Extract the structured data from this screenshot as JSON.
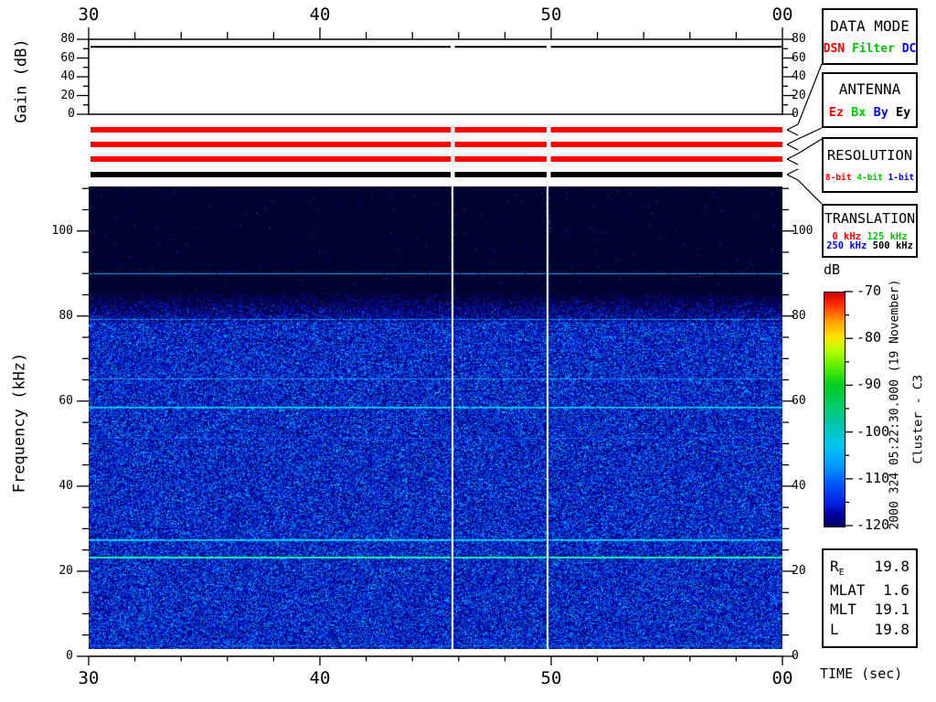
{
  "titles": {
    "gain_ylabel": "Gain (dB)",
    "freq_ylabel": "Frequency (kHz)",
    "time_label": "TIME (sec)",
    "db_label": "dB",
    "timestamp_vertical": "2000 324 05:22:30.000 (19 November)",
    "spacecraft_vertical": "Cluster - C3"
  },
  "axes": {
    "time_ticks": [
      "30",
      "40",
      "50",
      "00"
    ],
    "gain_ticks": [
      "0",
      "20",
      "40",
      "60",
      "80"
    ],
    "freq_ticks": [
      "0",
      "20",
      "40",
      "60",
      "80",
      "100"
    ],
    "colorbar_ticks": [
      "-70",
      "-80",
      "-90",
      "-100",
      "-110",
      "-120"
    ]
  },
  "legend": {
    "data_mode": {
      "title": "DATA MODE",
      "values": [
        {
          "text": "DSN",
          "color": "#ff0000"
        },
        {
          "text": "Filter",
          "color": "#00cc00"
        },
        {
          "text": "DC",
          "color": "#0000ff"
        }
      ]
    },
    "antenna": {
      "title": "ANTENNA",
      "values": [
        {
          "text": "Ez",
          "color": "#ff0000"
        },
        {
          "text": "Bx",
          "color": "#00cc00"
        },
        {
          "text": "By",
          "color": "#0000ff"
        },
        {
          "text": "Ey",
          "color": "#000000"
        }
      ]
    },
    "resolution": {
      "title": "RESOLUTION",
      "values": [
        {
          "text": "8-bit",
          "color": "#ff0000"
        },
        {
          "text": "4-bit",
          "color": "#00cc00"
        },
        {
          "text": "1-bit",
          "color": "#0000ff"
        }
      ]
    },
    "translation": {
      "title": "TRANSLATION",
      "rows": [
        [
          {
            "text": "0 kHz",
            "color": "#ff0000"
          },
          {
            "text": "125 kHz",
            "color": "#00cc00"
          }
        ],
        [
          {
            "text": "250 kHz",
            "color": "#0000ff"
          },
          {
            "text": "500 kHz",
            "color": "#000000"
          }
        ]
      ]
    }
  },
  "orbit": {
    "rows": [
      {
        "label": "R",
        "sub": "E",
        "value": "19.8"
      },
      {
        "label": "MLAT",
        "sub": "",
        "value": "1.6"
      },
      {
        "label": "MLT",
        "sub": "",
        "value": "19.1"
      },
      {
        "label": "L",
        "sub": "",
        "value": "19.8"
      }
    ]
  },
  "status_bars": [
    {
      "name": "data-mode-bar",
      "color": "#ff0000",
      "indicates": "DSN"
    },
    {
      "name": "antenna-bar",
      "color": "#ff0000",
      "indicates": "Ez"
    },
    {
      "name": "resolution-bar",
      "color": "#ff0000",
      "indicates": "8-bit"
    },
    {
      "name": "translation-bar",
      "color": "#000000",
      "indicates": "500 kHz"
    }
  ],
  "chart_data": [
    {
      "type": "line",
      "title": "Receiver gain vs time",
      "ylabel": "Gain (dB)",
      "xlabel": "",
      "ylim": [
        0,
        80
      ],
      "x_tick_labels": [
        "30",
        "40",
        "50",
        "00"
      ],
      "grid": false,
      "legend_position": "none",
      "series": [
        {
          "name": "gain",
          "description": "flat constant trace",
          "value_db": 72,
          "gap_times_sec": [
            45.7,
            49.9
          ]
        }
      ]
    },
    {
      "type": "heatmap",
      "title": "Cluster C3 WBD wideband spectrogram",
      "xlabel": "TIME (sec)",
      "ylabel": "Frequency (kHz)",
      "xlim_sec": [
        30,
        60
      ],
      "x_tick_labels": [
        "30",
        "40",
        "50",
        "00"
      ],
      "ylim_khz": [
        0,
        110.5
      ],
      "y_ticks_khz": [
        0,
        20,
        40,
        60,
        80,
        100
      ],
      "start_time": "2000 324 05:22:30.000 (19 November)",
      "spacecraft": "Cluster - C3",
      "colorbar": {
        "label": "dB",
        "range_db": [
          -120,
          -70
        ],
        "ticks_db": [
          -70,
          -80,
          -90,
          -100,
          -110,
          -120
        ],
        "palette": "rainbow: red at -70 dB through yellow, green, cyan, blue to dark navy at -120 dB"
      },
      "features": {
        "broadband_blue_noise_khz": [
          0,
          80
        ],
        "dark_background_above_khz": 80,
        "horizontal_interference_lines_khz": [
          90,
          79,
          72.5,
          65,
          58.5,
          51.5,
          27.5,
          23.5,
          15
        ],
        "strong_lines": [
          {
            "khz": 23.5,
            "color": "bright green"
          },
          {
            "khz": 58.5,
            "color": "cyan-green"
          },
          {
            "khz": 27.5,
            "color": "cyan-green"
          },
          {
            "khz": 90,
            "color": "cyan"
          }
        ],
        "vertical_white_data_gap_times_sec": [
          45.7,
          49.9
        ]
      }
    }
  ]
}
